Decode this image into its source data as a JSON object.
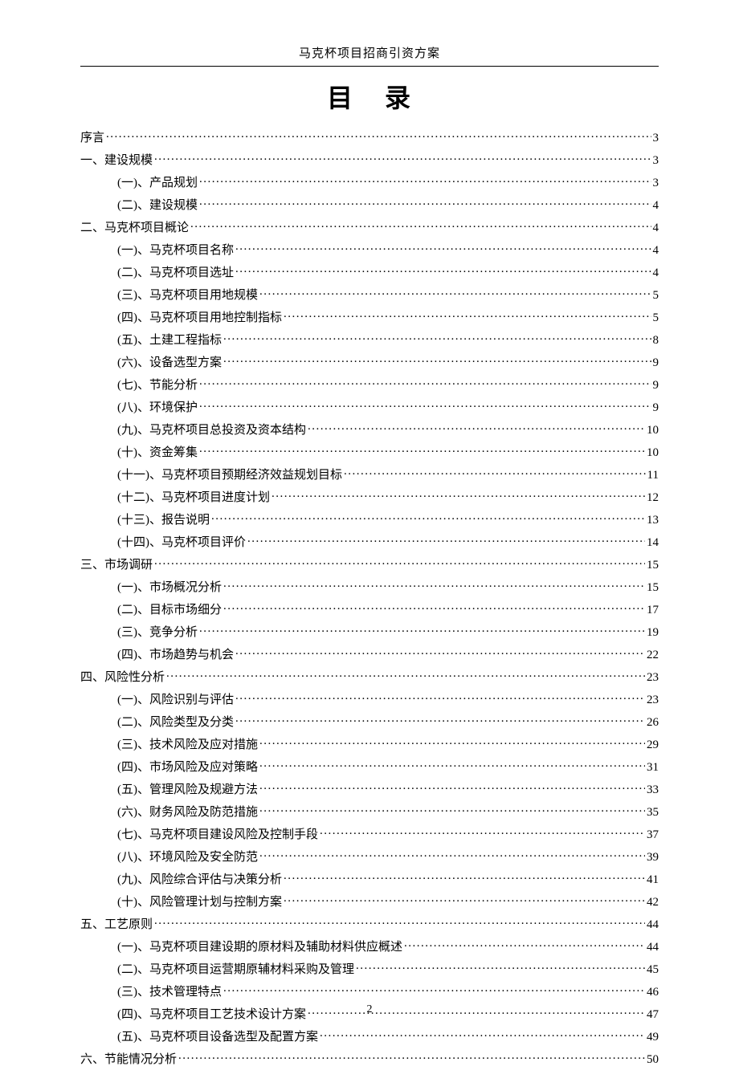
{
  "header": "马克杯项目招商引资方案",
  "title": "目 录",
  "page_number": "2",
  "toc": [
    {
      "level": 1,
      "label": "序言",
      "page": "3"
    },
    {
      "level": 1,
      "label": "一、建设规模",
      "page": "3"
    },
    {
      "level": 2,
      "label": "(一)、产品规划",
      "page": "3"
    },
    {
      "level": 2,
      "label": "(二)、建设规模",
      "page": "4"
    },
    {
      "level": 1,
      "label": "二、马克杯项目概论",
      "page": "4"
    },
    {
      "level": 2,
      "label": "(一)、马克杯项目名称",
      "page": "4"
    },
    {
      "level": 2,
      "label": "(二)、马克杯项目选址",
      "page": "4"
    },
    {
      "level": 2,
      "label": "(三)、马克杯项目用地规模",
      "page": "5"
    },
    {
      "level": 2,
      "label": "(四)、马克杯项目用地控制指标",
      "page": "5"
    },
    {
      "level": 2,
      "label": "(五)、土建工程指标",
      "page": "8"
    },
    {
      "level": 2,
      "label": "(六)、设备选型方案",
      "page": "9"
    },
    {
      "level": 2,
      "label": "(七)、节能分析",
      "page": "9"
    },
    {
      "level": 2,
      "label": "(八)、环境保护",
      "page": "9"
    },
    {
      "level": 2,
      "label": "(九)、马克杯项目总投资及资本结构",
      "page": "10"
    },
    {
      "level": 2,
      "label": "(十)、资金筹集",
      "page": "10"
    },
    {
      "level": 2,
      "label": "(十一)、马克杯项目预期经济效益规划目标",
      "page": "11"
    },
    {
      "level": 2,
      "label": "(十二)、马克杯项目进度计划",
      "page": "12"
    },
    {
      "level": 2,
      "label": "(十三)、报告说明",
      "page": "13"
    },
    {
      "level": 2,
      "label": "(十四)、马克杯项目评价",
      "page": "14"
    },
    {
      "level": 1,
      "label": "三、市场调研",
      "page": "15"
    },
    {
      "level": 2,
      "label": "(一)、市场概况分析",
      "page": "15"
    },
    {
      "level": 2,
      "label": "(二)、目标市场细分",
      "page": "17"
    },
    {
      "level": 2,
      "label": "(三)、竞争分析",
      "page": "19"
    },
    {
      "level": 2,
      "label": "(四)、市场趋势与机会",
      "page": "22"
    },
    {
      "level": 1,
      "label": "四、风险性分析",
      "page": "23"
    },
    {
      "level": 2,
      "label": "(一)、风险识别与评估",
      "page": "23"
    },
    {
      "level": 2,
      "label": "(二)、风险类型及分类",
      "page": "26"
    },
    {
      "level": 2,
      "label": "(三)、技术风险及应对措施",
      "page": "29"
    },
    {
      "level": 2,
      "label": "(四)、市场风险及应对策略",
      "page": "31"
    },
    {
      "level": 2,
      "label": "(五)、管理风险及规避方法",
      "page": "33"
    },
    {
      "level": 2,
      "label": "(六)、财务风险及防范措施",
      "page": "35"
    },
    {
      "level": 2,
      "label": "(七)、马克杯项目建设风险及控制手段",
      "page": "37"
    },
    {
      "level": 2,
      "label": "(八)、环境风险及安全防范",
      "page": "39"
    },
    {
      "level": 2,
      "label": "(九)、风险综合评估与决策分析",
      "page": "41"
    },
    {
      "level": 2,
      "label": "(十)、风险管理计划与控制方案",
      "page": "42"
    },
    {
      "level": 1,
      "label": "五、工艺原则",
      "page": "44"
    },
    {
      "level": 2,
      "label": "(一)、马克杯项目建设期的原材料及辅助材料供应概述",
      "page": "44"
    },
    {
      "level": 2,
      "label": "(二)、马克杯项目运营期原辅材料采购及管理",
      "page": "45"
    },
    {
      "level": 2,
      "label": "(三)、技术管理特点",
      "page": "46"
    },
    {
      "level": 2,
      "label": "(四)、马克杯项目工艺技术设计方案",
      "page": "47"
    },
    {
      "level": 2,
      "label": "(五)、马克杯项目设备选型及配置方案",
      "page": "49"
    },
    {
      "level": 1,
      "label": "六、节能情况分析",
      "page": "50"
    }
  ]
}
